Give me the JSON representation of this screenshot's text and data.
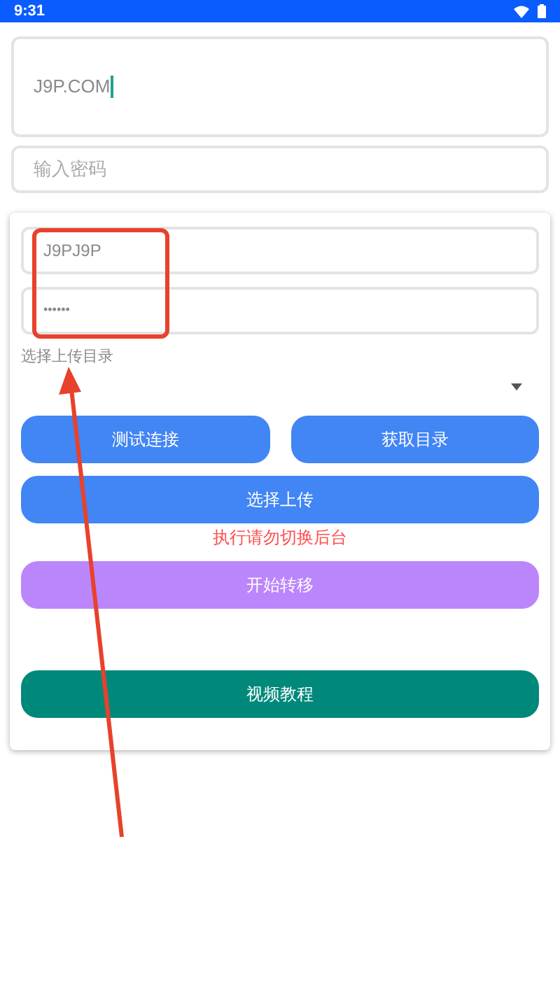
{
  "status_bar": {
    "time": "9:31"
  },
  "host_field": {
    "value": "J9P.COM",
    "focused": true
  },
  "password_field": {
    "placeholder": "输入密码"
  },
  "card": {
    "user_field": {
      "value": "J9PJ9P"
    },
    "secret_field": {
      "value": "••••••"
    },
    "directory_label": "选择上传目录",
    "row_buttons": [
      {
        "label": "测试连接",
        "color": "#4285f4"
      },
      {
        "label": "获取目录",
        "color": "#4285f4"
      }
    ],
    "upload_button": {
      "label": "选择上传",
      "color": "#4285f4"
    },
    "warning": "执行请勿切换后台",
    "transfer_button": {
      "label": "开始转移",
      "color": "#bb86fc"
    },
    "video_button": {
      "label": "视频教程",
      "color": "#00897b"
    }
  }
}
